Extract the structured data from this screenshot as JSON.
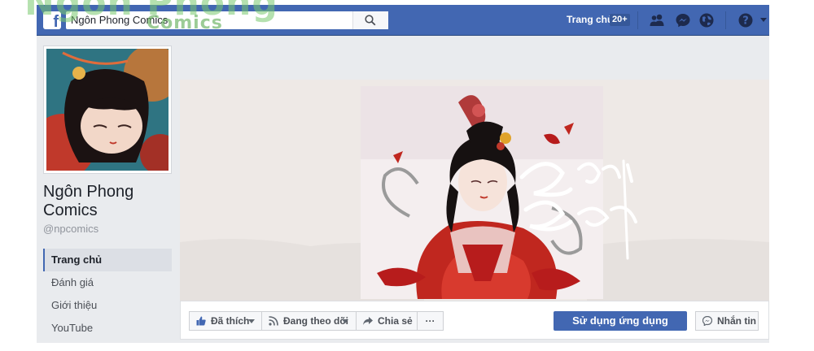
{
  "watermark": {
    "line1": "Ngôn Phong",
    "line2": "Comics"
  },
  "topbar": {
    "search_value": "Ngôn Phong Comics",
    "home_label": "Trang chủ",
    "home_badge": "20+",
    "icons": [
      "friends-icon",
      "messenger-icon",
      "globe-icon",
      "help-icon"
    ]
  },
  "page": {
    "name": "Ngôn Phong Comics",
    "handle": "@npcomics"
  },
  "sidebar": {
    "items": [
      {
        "label": "Trang chủ",
        "active": true
      },
      {
        "label": "Đánh giá",
        "active": false
      },
      {
        "label": "Giới thiệu",
        "active": false
      },
      {
        "label": "YouTube",
        "active": false
      }
    ]
  },
  "cover": {
    "calligraphy": "Ngôn Phong"
  },
  "actions": {
    "liked_label": "Đã thích",
    "following_label": "Đang theo dõi",
    "share_label": "Chia sẻ",
    "more_label": "···",
    "use_app_label": "Sử dụng ứng dụng",
    "message_label": "Nhắn tin"
  },
  "colors": {
    "brand": "#4267b2",
    "page_bg": "#e9ebee"
  }
}
